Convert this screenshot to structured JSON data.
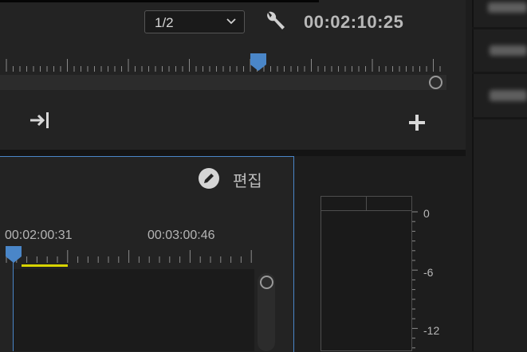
{
  "program_monitor": {
    "resolution": {
      "selected": "1/2"
    },
    "timecode": "00:02:10:25",
    "icons": {
      "settings": "wrench-icon",
      "goto_out": "go-to-out-icon",
      "add": "plus-icon"
    }
  },
  "source_panel": {
    "edit_label": "편집",
    "edit_icon": "pencil-circle-icon",
    "timecodes": [
      "00:02:00:31",
      "00:03:00:46"
    ]
  },
  "audio_meter": {
    "scale": [
      "0",
      "-6",
      "-12"
    ]
  },
  "colors": {
    "accent": "#4a86c8",
    "marker": "#d8d400",
    "background": "#232323"
  }
}
